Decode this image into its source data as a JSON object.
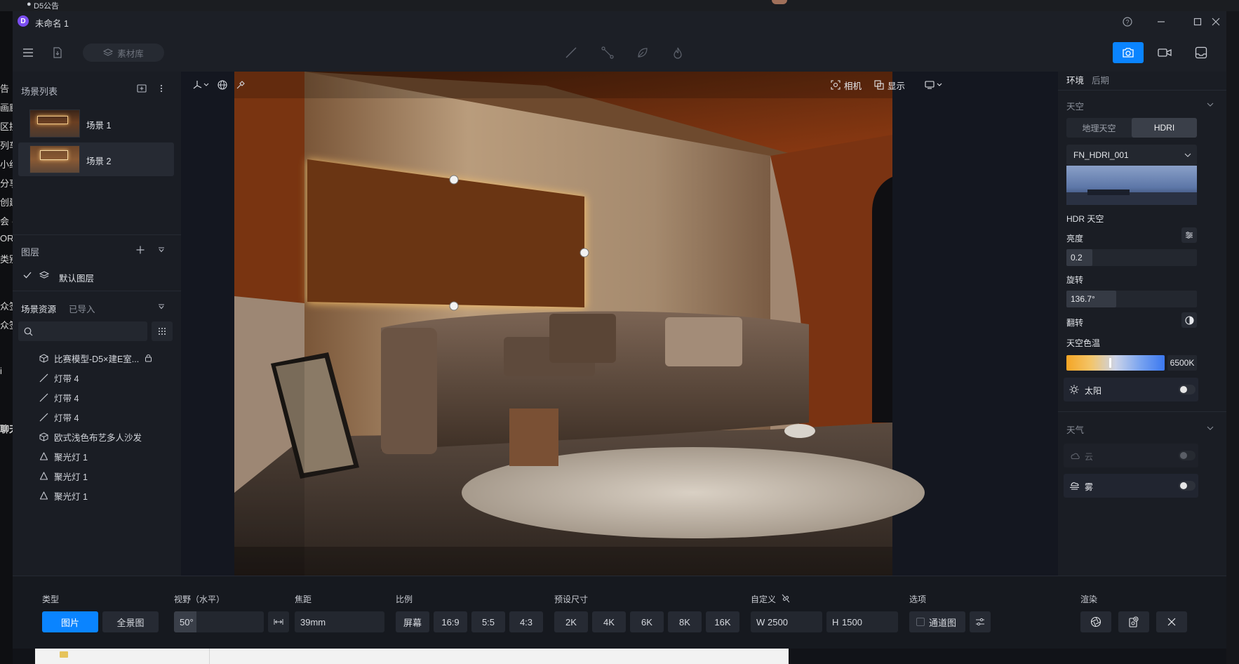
{
  "desktop": {
    "top_notice": "D5公告",
    "left_fragments": [
      "告",
      "画廊",
      "区拱",
      "列车",
      "小组",
      "分享",
      "创建",
      "会 ●",
      "ORK",
      "类别",
      "众签",
      "众签",
      "i",
      "聊天"
    ]
  },
  "window": {
    "title": "未命名 1"
  },
  "toolbar": {
    "asset_library_label": "素材库"
  },
  "scene_list": {
    "title": "场景列表",
    "items": [
      {
        "label": "场景 1"
      },
      {
        "label": "场景 2"
      }
    ]
  },
  "layers": {
    "title": "图层",
    "items": [
      {
        "label": "默认图层"
      }
    ]
  },
  "scene_assets": {
    "tab_active": "场景资源",
    "tab_other": "已导入",
    "items": [
      {
        "icon": "cube-icon",
        "label": "比赛模型-D5×建E室..."
      },
      {
        "icon": "line-icon",
        "label": "灯带 4"
      },
      {
        "icon": "line-icon",
        "label": "灯带 4"
      },
      {
        "icon": "line-icon",
        "label": "灯带 4"
      },
      {
        "icon": "cube-icon",
        "label": "欧式浅色布艺多人沙发"
      },
      {
        "icon": "spotlight-icon",
        "label": "聚光灯 1"
      },
      {
        "icon": "spotlight-icon",
        "label": "聚光灯 1"
      },
      {
        "icon": "spotlight-icon",
        "label": "聚光灯 1"
      }
    ]
  },
  "viewport": {
    "camera_label": "相机",
    "display_label": "显示"
  },
  "right_panel": {
    "tab_env": "环境",
    "tab_post": "后期",
    "sky_title": "天空",
    "sky_tabs": [
      "地理天空",
      "HDRI"
    ],
    "hdri_name": "FN_HDRI_001",
    "hdr_sky_label": "HDR 天空",
    "brightness_label": "亮度",
    "brightness_value": "0.2",
    "brightness_level": 0.2,
    "rotation_label": "旋转",
    "rotation_value": "136.7°",
    "rotation_level": 0.38,
    "flip_label": "翻转",
    "sky_temp_label": "天空色温",
    "sky_temp_value": "6500K",
    "sun_label": "太阳",
    "weather_title": "天气",
    "cloud_label": "云",
    "fog_label": "雾"
  },
  "bottom_bar": {
    "type_label": "类型",
    "type_options": [
      "图片",
      "全景图"
    ],
    "fov_label": "视野（水平）",
    "fov_value": "50°",
    "focal_label": "焦距",
    "focal_value": "39mm",
    "ratio_label": "比例",
    "ratio_options": [
      "屏幕",
      "16:9",
      "5:5",
      "4:3"
    ],
    "preset_label": "预设尺寸",
    "preset_options": [
      "2K",
      "4K",
      "6K",
      "8K",
      "16K"
    ],
    "custom_label": "自定义",
    "width_prefix": "W",
    "width_value": "2500",
    "height_prefix": "H",
    "height_value": "1500",
    "options_label": "选项",
    "channel_label": "通道图",
    "render_label": "渲染"
  },
  "colors": {
    "accent": "#0a84ff",
    "panel": "#1a1d24",
    "window": "#1c1f26"
  }
}
